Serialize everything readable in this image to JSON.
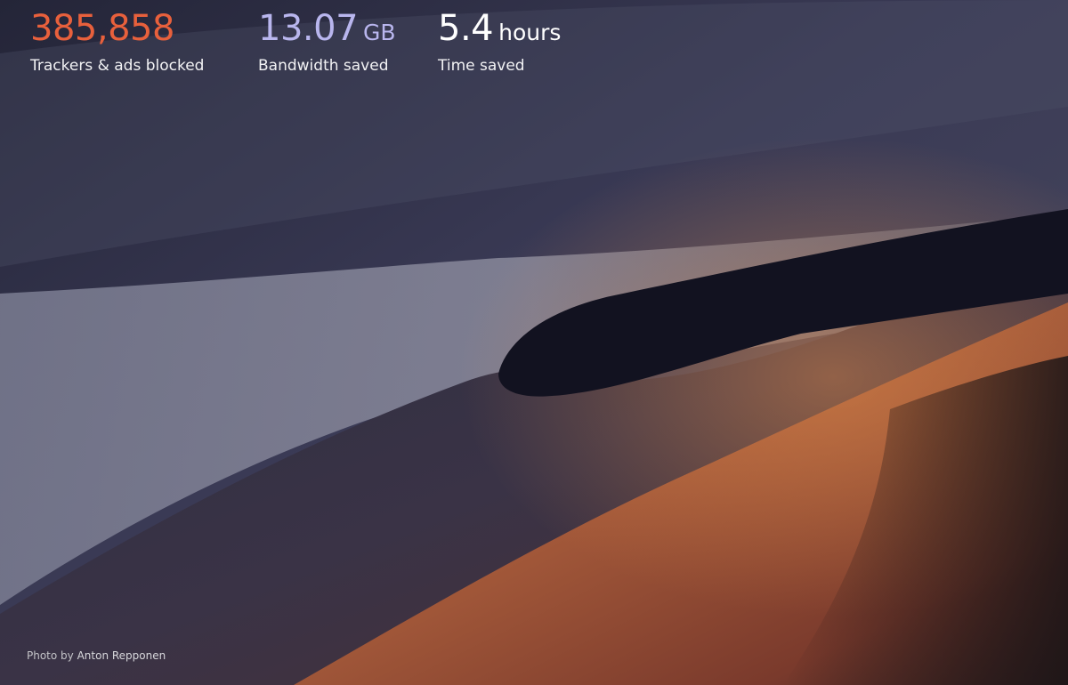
{
  "stats": {
    "trackers": {
      "value": "385,858",
      "label": "Trackers & ads blocked"
    },
    "bandwidth": {
      "value": "13.07",
      "unit": "GB",
      "label": "Bandwidth saved"
    },
    "time": {
      "value": "5.4",
      "unit": "hours",
      "label": "Time saved"
    }
  },
  "colors": {
    "trackers": "#e8603c",
    "bandwidth": "#b9b6ee",
    "time": "#ffffff"
  },
  "photo_credit": {
    "prefix": "Photo by",
    "author": "Anton Repponen"
  }
}
